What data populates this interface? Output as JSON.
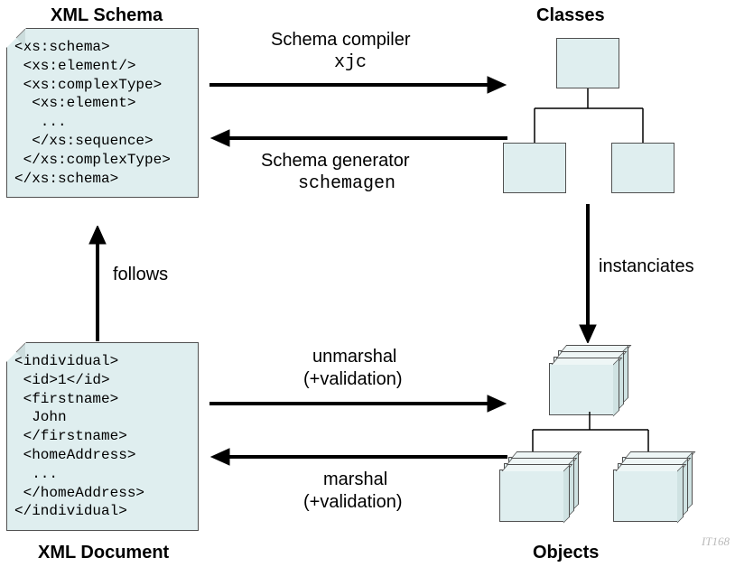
{
  "titles": {
    "schema": "XML Schema",
    "classes": "Classes",
    "document": "XML Document",
    "objects": "Objects"
  },
  "schema_lines": {
    "l0": "<xs:schema>",
    "l1": " <xs:element/>",
    "l2": " <xs:complexType>",
    "l3": "  <xs:element>",
    "l4": "   ...",
    "l5": "  </xs:sequence>",
    "l6": " </xs:complexType>",
    "l7": "</xs:schema>"
  },
  "doc_lines": {
    "l0": "<individual>",
    "l1": " <id>1</id>",
    "l2": " <firstname>",
    "l3": "  John",
    "l4": " </firstname>",
    "l5": " <homeAddress>",
    "l6": "  ...",
    "l7": " </homeAddress>",
    "l8": "</individual>"
  },
  "arrows": {
    "compiler_top": "Schema compiler",
    "compiler_cmd": "xjc",
    "generator_top": "Schema generator",
    "generator_cmd": "schemagen",
    "follows": "follows",
    "instanciates": "instanciates",
    "unmarshal_top": "unmarshal",
    "unmarshal_sub": "(+validation)",
    "marshal_top": "marshal",
    "marshal_sub": "(+validation)"
  },
  "misc": {
    "watermark": "IT168"
  }
}
